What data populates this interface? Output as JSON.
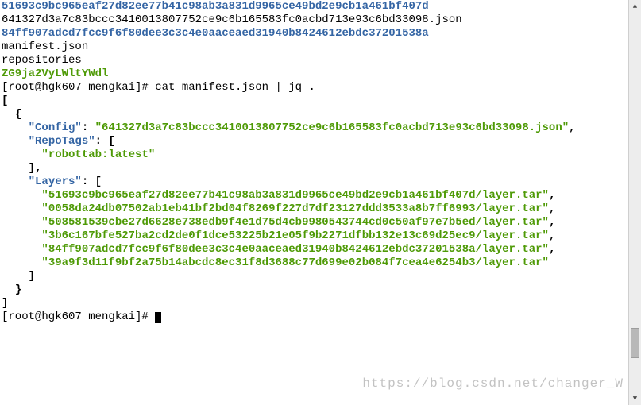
{
  "listing": {
    "dir_top": "51693c9bc965eaf27d82ee77b41c98ab3a831d9965ce49bd2e9cb1a461bf407d",
    "json_file": "641327d3a7c83bccc3410013807752ce9c6b165583fc0acbd713e93c6bd33098.json",
    "dir_mid": "84ff907adcd7fcc9f6f80dee3c3c4e0aaceaed31940b8424612ebdc37201538a",
    "manifest": "manifest.json",
    "repositories": "repositories",
    "dir_bottom": "ZG9ja2VyLWltYWdl"
  },
  "prompt": {
    "full": "[root@hgk607 mengkai]# cat manifest.json | jq ."
  },
  "json_out": {
    "open_bracket": "[",
    "open_brace": "  {",
    "config_key": "    \"Config\"",
    "colon": ": ",
    "config_val": "\"641327d3a7c83bccc3410013807752ce9c6b165583fc0acbd713e93c6bd33098.json\"",
    "repotags_key": "    \"RepoTags\"",
    "open_arr": ": [",
    "repotag_val": "      \"robottab:latest\"",
    "close_arr": "    ],",
    "layers_key": "    \"Layers\"",
    "layers_open": ": [",
    "layer1": "      \"51693c9bc965eaf27d82ee77b41c98ab3a831d9965ce49bd2e9cb1a461bf407d/layer.tar\"",
    "layer2": "      \"0058da24db07502ab1eb41bf2bd04f8269f227d7df23127ddd3533a8b7ff6993/layer.tar\"",
    "layer3": "      \"508581539cbe27d6628e738edb9f4e1d75d4cb9980543744cd0c50af97e7b5ed/layer.tar\"",
    "layer4": "      \"3b6c167bfe527ba2cd2de0f1dce53225b21e05f9b2271dfbb132e13c69d25ec9/layer.tar\"",
    "layer5": "      \"84ff907adcd7fcc9f6f80dee3c3c4e0aaceaed31940b8424612ebdc37201538a/layer.tar\"",
    "layer6": "      \"39a9f3d11f9bf2a75b14abcdc8ec31f8d3688c77d699e02b084f7cea4e6254b3/layer.tar\"",
    "layers_close": "    ]",
    "close_brace": "  }",
    "close_bracket": "]"
  },
  "prompt2_prefix": "[root@hgk607 mengkai]# ",
  "watermark": "https://blog.csdn.net/changer_W"
}
